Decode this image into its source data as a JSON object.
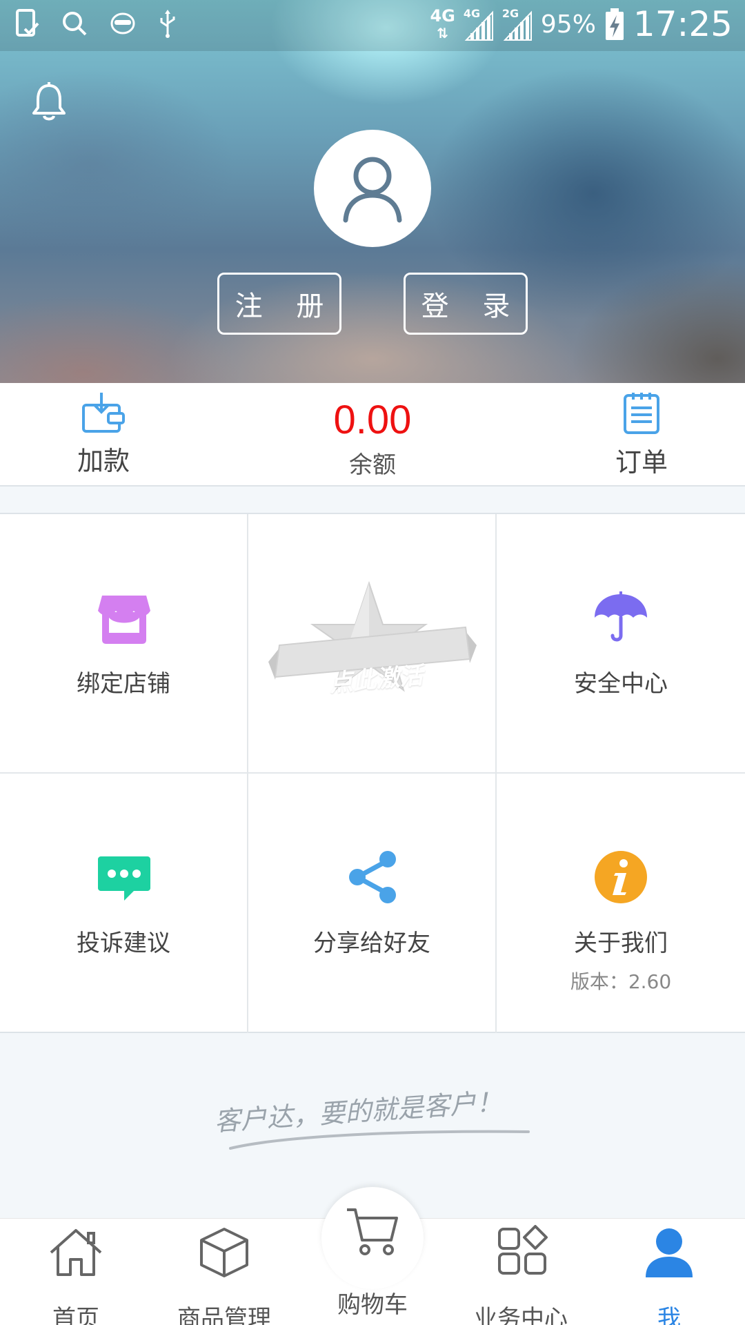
{
  "status_bar": {
    "network_primary": "4G",
    "network_sim1": "4G",
    "network_sim2": "2G",
    "battery": "95%",
    "time": "17:25"
  },
  "header": {
    "register_label": "注 册",
    "login_label": "登 录"
  },
  "summary": {
    "add_funds_label": "加款",
    "balance_value": "0.00",
    "balance_label": "余额",
    "orders_label": "订单"
  },
  "grid": {
    "bind_store": "绑定店铺",
    "activate": "点此激活",
    "security_center": "安全中心",
    "feedback": "投诉建议",
    "share": "分享给好友",
    "about": "关于我们",
    "version": "版本：2.60"
  },
  "slogan": "客户达，要的就是客户！",
  "tabbar": {
    "items": [
      {
        "label": "首页",
        "icon": "home-icon"
      },
      {
        "label": "商品管理",
        "icon": "box-icon"
      },
      {
        "label": "购物车",
        "icon": "cart-icon"
      },
      {
        "label": "业务中心",
        "icon": "apps-icon"
      },
      {
        "label": "我",
        "icon": "user-icon"
      }
    ],
    "active_index": 4,
    "active_color": "#2b85e4"
  },
  "colors": {
    "balance": "#ee1111",
    "bind_store_icon": "#d47ff0",
    "security_icon": "#7b6cf0",
    "feedback_icon": "#1dd1a1",
    "share_icon": "#4aa3e8",
    "about_icon": "#f5a623"
  }
}
